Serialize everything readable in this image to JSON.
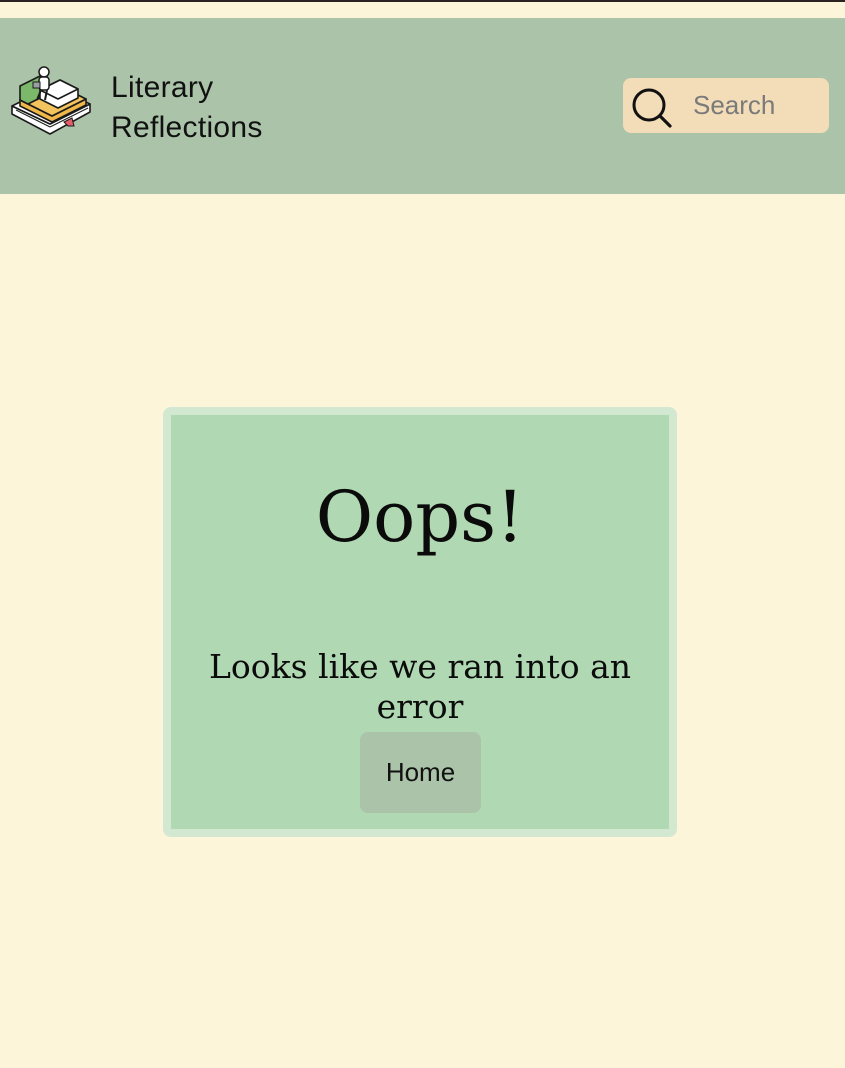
{
  "header": {
    "brand_line1": "Literary",
    "brand_line2": "Reflections",
    "logo_icon": "book-stack-reader-icon",
    "background": "#abc3a9"
  },
  "search": {
    "placeholder": "Search",
    "value": "",
    "icon": "search-icon",
    "background": "#f3dcb8"
  },
  "error": {
    "title": "Oops!",
    "message": "Looks like we ran into an error",
    "home_label": "Home",
    "card_background": "#b0d9b3"
  },
  "page": {
    "background": "#fdf5d9"
  }
}
